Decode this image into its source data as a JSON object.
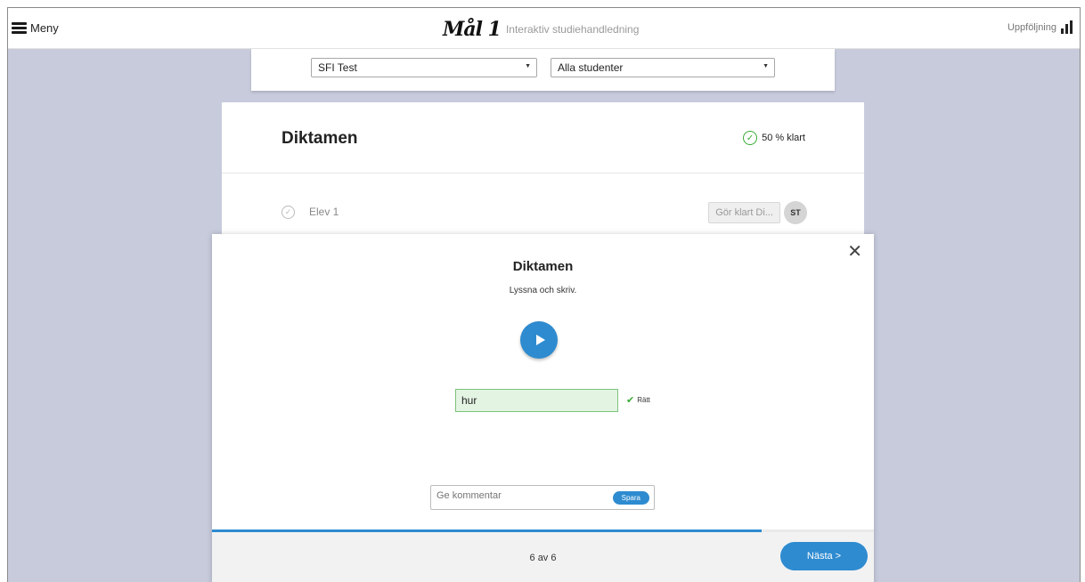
{
  "topbar": {
    "menu_label": "Meny",
    "logo_text": "Mål 1",
    "tagline": "Interaktiv studiehandledning",
    "followup_label": "Uppföljning"
  },
  "filters": {
    "course_selected": "SFI Test",
    "students_selected": "Alla studenter"
  },
  "task": {
    "title": "Diktamen",
    "progress_label": "50 % klart",
    "progress_percent": 50,
    "student_name": "Elev 1",
    "finish_button": "Gör klart Di...",
    "avatar_initials": "ST"
  },
  "modal": {
    "title": "Diktamen",
    "instruction": "Lyssna och skriv.",
    "answer_value": "hur",
    "result_label": "Rätt",
    "comment_placeholder": "Ge kommentar",
    "save_label": "Spara",
    "counter": "6 av 6",
    "progress_fraction": 0.83,
    "next_label": "Nästa >"
  },
  "colors": {
    "accent": "#2e8bd0",
    "success": "#3aaa35",
    "background": "#c7cbdc"
  }
}
